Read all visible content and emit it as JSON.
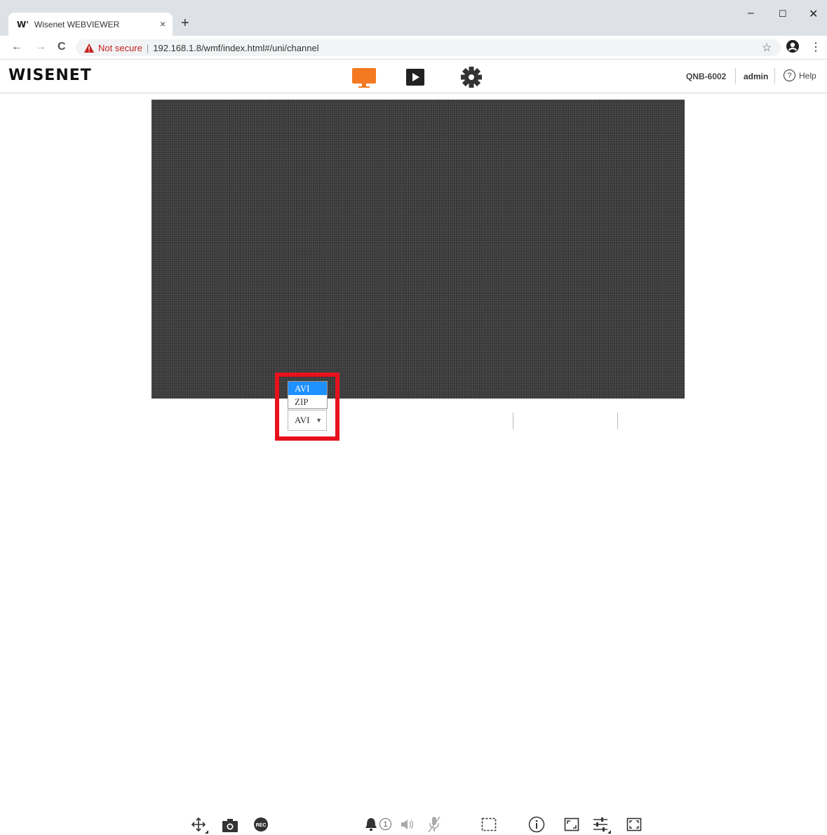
{
  "browser": {
    "tab_title": "Wisenet WEBVIEWER",
    "tab_logo": "W'",
    "tab_close": "×",
    "new_tab": "+",
    "not_secure": "Not secure",
    "separator": "|",
    "url": "192.168.1.8/wmf/index.html#/uni/channel",
    "back": "←",
    "forward": "→",
    "reload": "C",
    "minimize": "–",
    "maximize": "☐",
    "close": "✕",
    "star": "☆",
    "menu": "⋮"
  },
  "header": {
    "brand": "WISENET",
    "model": "QNB-6002",
    "user": "admin",
    "help": "Help",
    "help_icon": "?",
    "nav_icons": [
      "monitor-icon",
      "play-icon",
      "gear-icon"
    ],
    "accent": "#f47920"
  },
  "toolbar": {
    "format_selected": "AVI",
    "format_options": [
      "AVI",
      "ZIP"
    ],
    "alarm_count": "1",
    "rec_label": "REC"
  },
  "highlight_color": "#e8111e"
}
